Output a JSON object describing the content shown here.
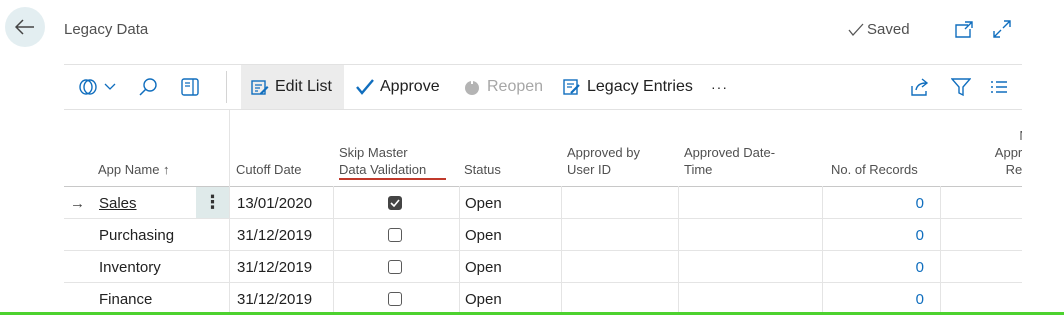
{
  "header": {
    "title": "Legacy Data",
    "saved_label": "Saved"
  },
  "toolbar": {
    "edit_list": "Edit List",
    "approve": "Approve",
    "reopen": "Reopen",
    "legacy_entries": "Legacy Entries",
    "more": "···"
  },
  "columns": {
    "app_name": "App Name",
    "sort_arrow": "↑",
    "cutoff_date": "Cutoff Date",
    "skip_line1": "Skip Master",
    "skip_line2": "Data Validation",
    "status": "Status",
    "approved_by_line1": "Approved by",
    "approved_by_line2": "User ID",
    "approved_date_line1": "Approved Date-",
    "approved_date_line2": "Time",
    "no_records": "No. of Records",
    "no_approved_line1": "No",
    "no_approved_line2": "Approv",
    "no_approved_line3": "Reco"
  },
  "rows": [
    {
      "app_name": "Sales",
      "cutoff_date": "13/01/2020",
      "skip": true,
      "status": "Open",
      "records": "0"
    },
    {
      "app_name": "Purchasing",
      "cutoff_date": "31/12/2019",
      "skip": false,
      "status": "Open",
      "records": "0"
    },
    {
      "app_name": "Inventory",
      "cutoff_date": "31/12/2019",
      "skip": false,
      "status": "Open",
      "records": "0"
    },
    {
      "app_name": "Finance",
      "cutoff_date": "31/12/2019",
      "skip": false,
      "status": "Open",
      "records": "0"
    }
  ],
  "colors": {
    "accent": "#106ebe",
    "underline_highlight": "#c0392b",
    "disabled": "#a7a7a7"
  }
}
